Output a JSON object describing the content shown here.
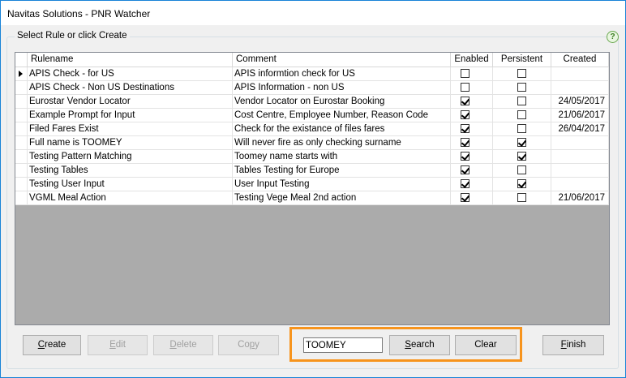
{
  "window": {
    "title": "Navitas Solutions - PNR Watcher"
  },
  "group": {
    "legend": "Select Rule or click Create",
    "help_glyph": "?"
  },
  "grid": {
    "headers": {
      "rulename": "Rulename",
      "comment": "Comment",
      "enabled": "Enabled",
      "persistent": "Persistent",
      "created": "Created"
    },
    "rows": [
      {
        "rulename": "APIS Check - for US",
        "comment": "APIS informtion check for US",
        "enabled": false,
        "persistent": false,
        "created": "",
        "current": true
      },
      {
        "rulename": "APIS Check - Non US Destinations",
        "comment": "APIS Information - non US",
        "enabled": false,
        "persistent": false,
        "created": ""
      },
      {
        "rulename": "Eurostar Vendor Locator",
        "comment": "Vendor Locator on Eurostar Booking",
        "enabled": true,
        "persistent": false,
        "created": "24/05/2017"
      },
      {
        "rulename": "Example Prompt for Input",
        "comment": "Cost Centre, Employee Number, Reason Code",
        "enabled": true,
        "persistent": false,
        "created": "21/06/2017"
      },
      {
        "rulename": "Filed Fares Exist",
        "comment": "Check for the existance of files fares",
        "enabled": true,
        "persistent": false,
        "created": "26/04/2017"
      },
      {
        "rulename": "Full name is TOOMEY",
        "comment": "Will never fire as only checking surname",
        "enabled": true,
        "persistent": true,
        "created": ""
      },
      {
        "rulename": "Testing Pattern Matching",
        "comment": "Toomey name starts with",
        "enabled": true,
        "persistent": true,
        "created": ""
      },
      {
        "rulename": "Testing Tables",
        "comment": "Tables Testing for Europe",
        "enabled": true,
        "persistent": false,
        "created": ""
      },
      {
        "rulename": "Testing User Input",
        "comment": "User Input Testing",
        "enabled": true,
        "persistent": true,
        "created": ""
      },
      {
        "rulename": "VGML Meal Action",
        "comment": "Testing Vege Meal 2nd action",
        "enabled": true,
        "persistent": false,
        "created": "21/06/2017"
      }
    ]
  },
  "buttons": {
    "create": {
      "mnemonic": "C",
      "rest": "reate",
      "enabled": true
    },
    "edit": {
      "mnemonic": "E",
      "rest": "dit",
      "enabled": false
    },
    "delete": {
      "mnemonic": "D",
      "rest": "elete",
      "enabled": false
    },
    "copy": {
      "pre": "Co",
      "mnemonic": "p",
      "rest": "y",
      "enabled": false
    },
    "search": {
      "mnemonic": "S",
      "rest": "earch",
      "enabled": true
    },
    "clear": {
      "label": "Clear",
      "enabled": true
    },
    "finish": {
      "mnemonic": "F",
      "rest": "inish",
      "enabled": true
    }
  },
  "search": {
    "value": "TOOMEY",
    "placeholder": ""
  },
  "colors": {
    "highlight_box": "#f7941d",
    "window_border": "#1883d7",
    "grid_empty_area": "#ababab"
  }
}
